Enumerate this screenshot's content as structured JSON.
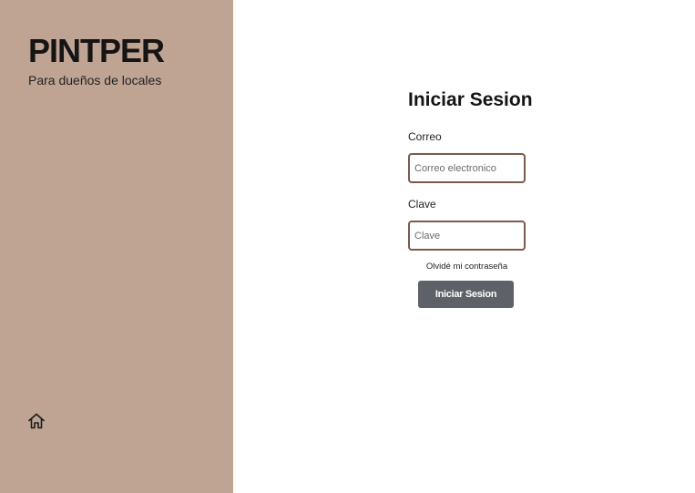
{
  "sidebar": {
    "brand": "PINTPER",
    "tagline": "Para dueños de locales",
    "home_icon": "home-icon"
  },
  "login": {
    "title": "Iniciar Sesion",
    "email_label": "Correo",
    "email_placeholder": "Correo electronico",
    "password_label": "Clave",
    "password_placeholder": "Clave",
    "forgot_link": "Olvidé mi contraseña",
    "submit_label": "Iniciar Sesion"
  },
  "colors": {
    "sidebar_bg": "#bfa493",
    "input_border": "#7a5a4d",
    "button_bg": "#5f6169",
    "main_bg": "#ffffff"
  }
}
